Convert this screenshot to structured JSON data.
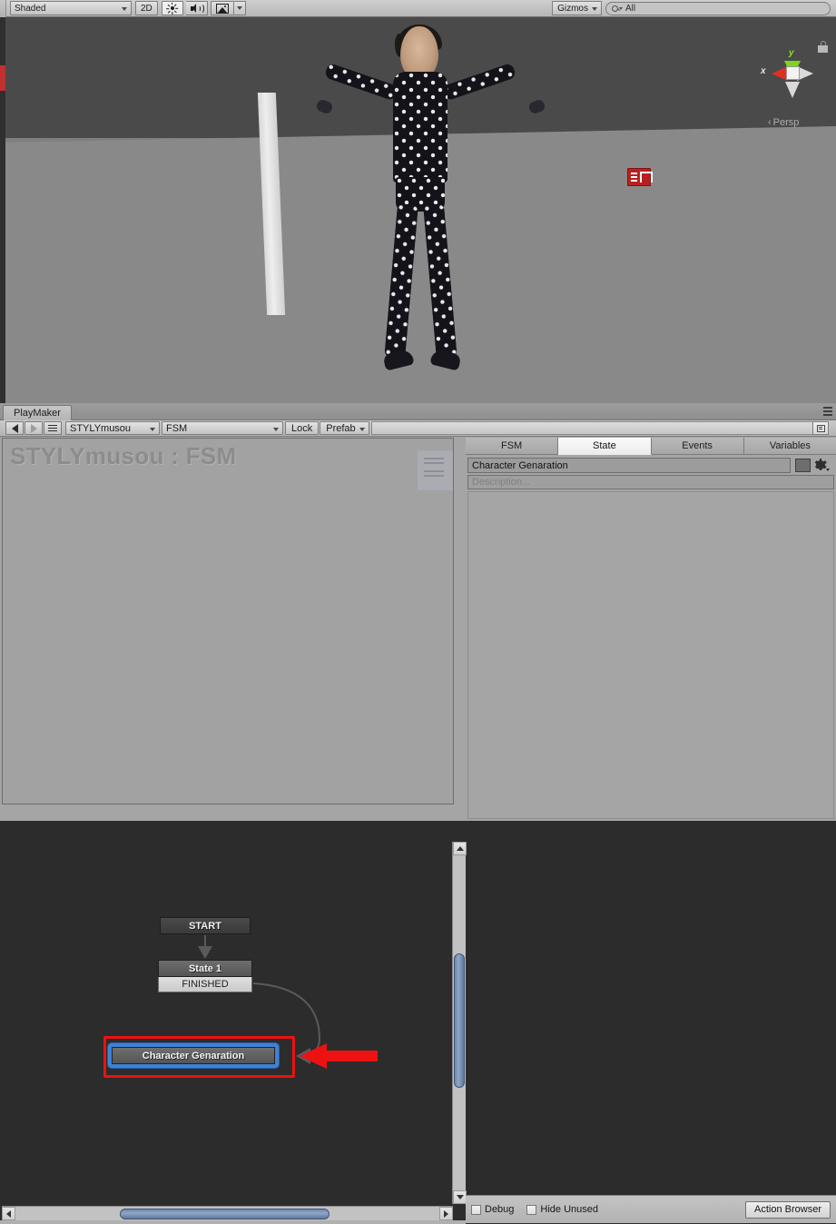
{
  "scene_toolbar": {
    "draw_mode": "Shaded",
    "mode_2d": "2D",
    "lighting_icon": "sun-icon",
    "audio_icon": "speaker-icon",
    "effects_icon": "image-icon",
    "gizmos_label": "Gizmos",
    "search_value": "All",
    "search_placeholder": "All"
  },
  "scene_view": {
    "axis_x_label": "x",
    "axis_y_label": "y",
    "projection_label": "Persp",
    "projection_prefix": "‹",
    "lock_icon": "lock-icon",
    "gizmo_icon": "scene-gizmo-icon"
  },
  "playmaker": {
    "tab_label": "PlayMaker",
    "panel_menu_icon": "panel-menu-icon",
    "toolbar": {
      "back_icon": "arrow-left-icon",
      "forward_icon": "arrow-right-icon",
      "menu_icon": "hamburger-menu-icon",
      "game_object": "STYLYmusou",
      "fsm": "FSM",
      "lock_label": "Lock",
      "prefab_label": "Prefab",
      "dock_icon": "dock-layout-icon"
    },
    "graph": {
      "title": "STYLYmusou : FSM",
      "minimap_name": "fsm-minimap",
      "nodes": [
        {
          "id": "start",
          "title": "START",
          "events": []
        },
        {
          "id": "state1",
          "title": "State 1",
          "events": [
            "FINISHED"
          ]
        },
        {
          "id": "character",
          "title": "Character Genaration",
          "events": [],
          "selected": true
        }
      ],
      "annotation": {
        "box_color": "#ee1111",
        "arrow_color": "#ee1111"
      },
      "scrollbar_color": "#7d96b8"
    },
    "inspector": {
      "tabs": [
        {
          "label": "FSM",
          "active": false
        },
        {
          "label": "State",
          "active": true
        },
        {
          "label": "Events",
          "active": false
        },
        {
          "label": "Variables",
          "active": false
        }
      ],
      "state_name": "Character Genaration",
      "description_placeholder": "Description...",
      "color_swatch": "#6e6e6e",
      "gear_icon": "gear-icon"
    },
    "bottom_bar": {
      "debug_label": "Debug",
      "debug_checked": false,
      "hide_unused_label": "Hide Unused",
      "hide_unused_checked": false,
      "action_browser_label": "Action Browser"
    }
  },
  "colors": {
    "selection_blue": "#3d82d6",
    "annotation_red": "#ee1111",
    "axis_x": "#e03020",
    "axis_y": "#7fd320",
    "scene_sky": "#4a4a4a",
    "scene_ground": "#8a8989"
  }
}
